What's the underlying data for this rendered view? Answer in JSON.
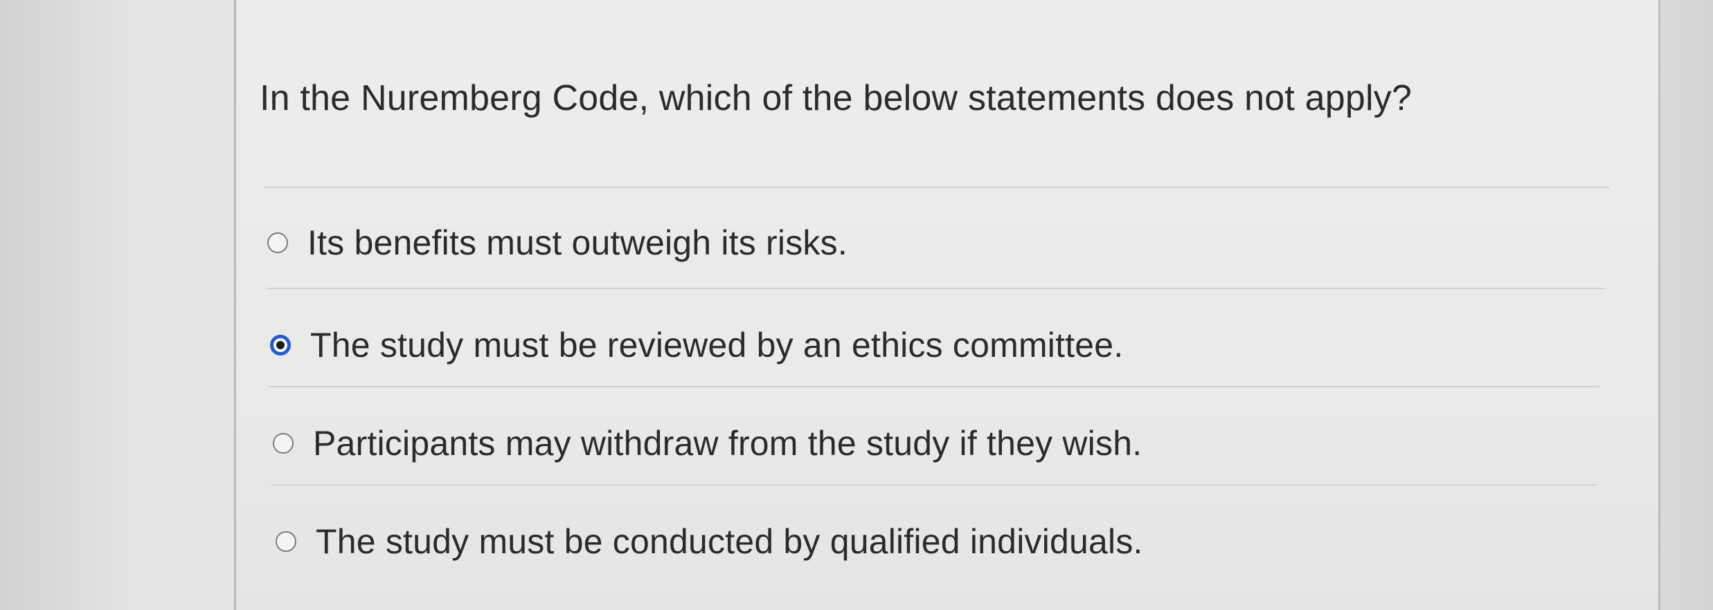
{
  "question": {
    "text": "In the Nuremberg Code, which of the below statements does not apply?"
  },
  "options": [
    {
      "label": "Its benefits must outweigh its risks.",
      "selected": false
    },
    {
      "label": "The study must be reviewed by an ethics committee.",
      "selected": true
    },
    {
      "label": "Participants may withdraw from the study if they wish.",
      "selected": false
    },
    {
      "label": "The study must be conducted by qualified individuals.",
      "selected": false
    }
  ],
  "colors": {
    "selected_accent": "#1f5bd6",
    "text": "#2b2b2b",
    "panel": "#ebebe9"
  }
}
